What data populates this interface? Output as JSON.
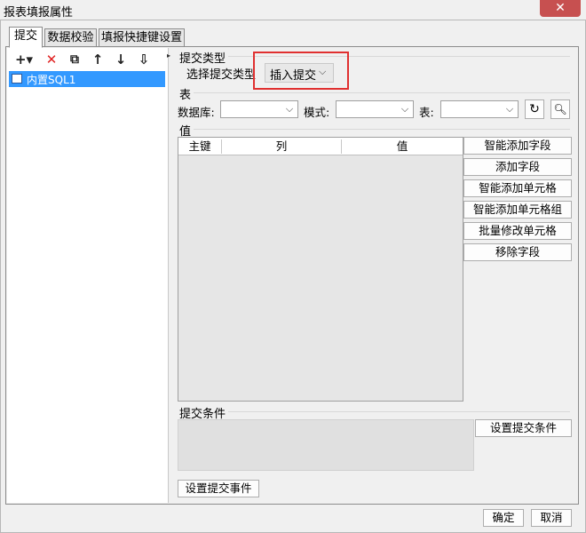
{
  "window": {
    "title": "报表填报属性",
    "close_symbol": "✕"
  },
  "tabs": [
    {
      "label": "提交"
    },
    {
      "label": "数据校验"
    },
    {
      "label": "填报快捷键设置"
    }
  ],
  "toolbar": {
    "add": "+▾",
    "delete": "✕",
    "copy": "⧉",
    "up": "↑",
    "down": "↓",
    "sort": "⇩"
  },
  "tree": {
    "items": [
      {
        "label": "内置SQL1"
      }
    ]
  },
  "submit_type": {
    "section_label": "提交类型",
    "select_label": "选择提交类型",
    "selected": "插入提交"
  },
  "table_section": {
    "section_label": "表",
    "database_label": "数据库:",
    "database_value": "",
    "schema_label": "模式:",
    "schema_value": "",
    "table_label": "表:",
    "table_value": "",
    "refresh_icon": "refresh-icon",
    "preview_icon": "preview-icon"
  },
  "value_section": {
    "section_label": "值",
    "columns": [
      "主键",
      "列",
      "值"
    ],
    "rows": [],
    "buttons": [
      "智能添加字段",
      "添加字段",
      "智能添加单元格",
      "智能添加单元格组",
      "批量修改单元格",
      "移除字段"
    ]
  },
  "condition_section": {
    "section_label": "提交条件",
    "set_condition_button": "设置提交条件"
  },
  "event_button": "设置提交事件",
  "footer": {
    "ok": "确定",
    "cancel": "取消"
  },
  "colors": {
    "selection": "#3399ff",
    "highlight_box": "#e03030",
    "close_button": "#c75050"
  }
}
